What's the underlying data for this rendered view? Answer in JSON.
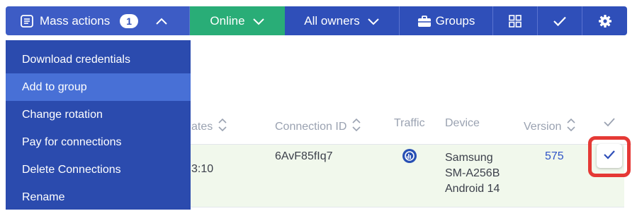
{
  "toolbar": {
    "mass_actions_label": "Mass actions",
    "mass_actions_count": "1",
    "online_label": "Online",
    "owners_label": "All owners",
    "groups_label": "Groups"
  },
  "menu": {
    "items": [
      {
        "label": "Download credentials"
      },
      {
        "label": "Add to group"
      },
      {
        "label": "Change rotation"
      },
      {
        "label": "Pay for connections"
      },
      {
        "label": "Delete Connections"
      },
      {
        "label": "Rename"
      }
    ],
    "active_index": 1
  },
  "table": {
    "headers": {
      "dates_partial": "ates",
      "connection_id": "Connection ID",
      "traffic": "Traffic",
      "device": "Device",
      "version": "Version"
    },
    "row": {
      "time_partial": "3:10",
      "connection_id": "6AvF85fIq7",
      "device_line1": "Samsung",
      "device_line2": "SM-A256B",
      "device_line3": "Android 14",
      "version": "575",
      "selected": true
    }
  },
  "colors": {
    "primary": "#2f4fb9",
    "online_green": "#29ad77",
    "menu_bg": "#2b4bae",
    "menu_active": "#4870d6",
    "row_selected_bg": "#f1f8ec",
    "highlight_red": "#e53935"
  },
  "icons": {
    "mass_actions": "document-list-icon",
    "chevron_up": "chevron-up-icon",
    "chevron_down": "chevron-down-icon",
    "groups": "briefcase-icon",
    "grid": "grid-icon",
    "check": "check-icon",
    "settings": "gear-icon",
    "traffic": "traffic-chart-icon",
    "sort": "sort-icon"
  }
}
